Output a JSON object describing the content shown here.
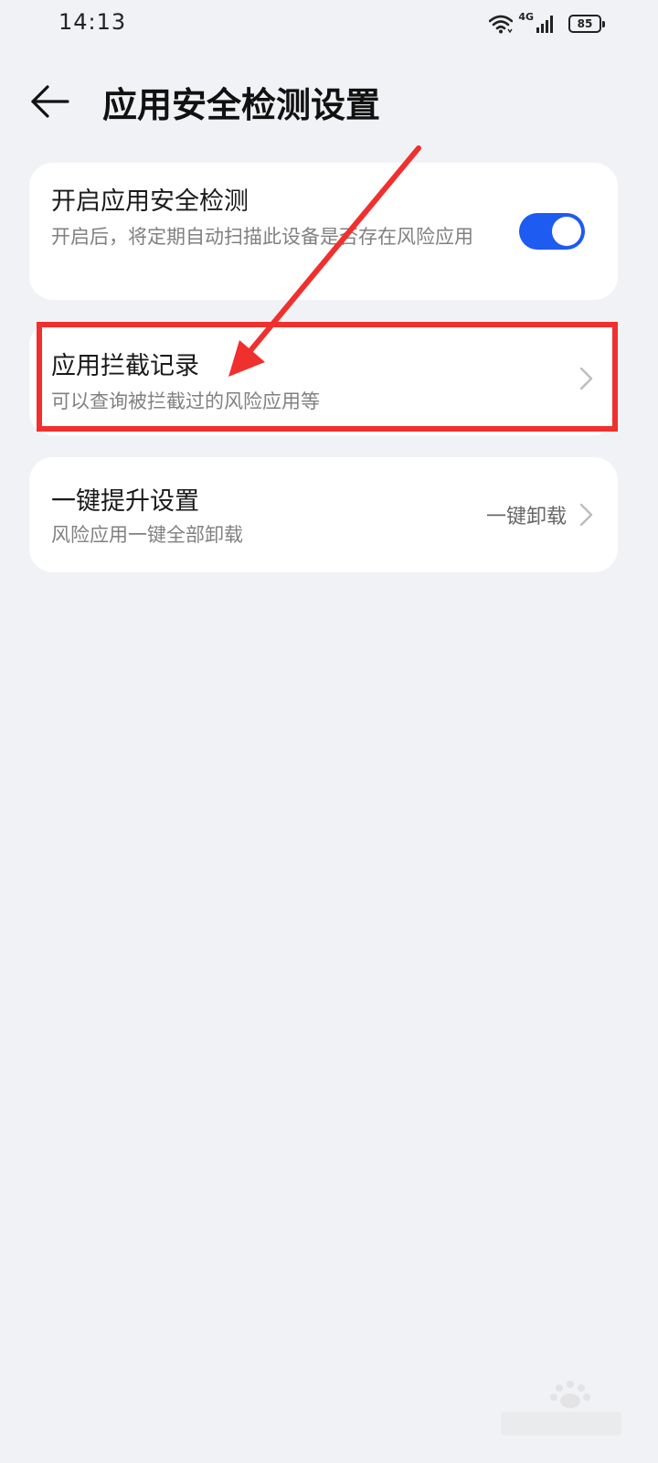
{
  "status_bar": {
    "time": "14:13",
    "network": "4G",
    "battery": "85",
    "icons": [
      "wifi-icon",
      "signal-icon",
      "battery-icon"
    ]
  },
  "header": {
    "title": "应用安全检测设置",
    "back_icon": "back-arrow-icon"
  },
  "settings": {
    "security_scan": {
      "title": "开启应用安全检测",
      "subtitle": "开启后，将定期自动扫描此设备是否存在风险应用",
      "enabled": true
    },
    "block_records": {
      "title": "应用拦截记录",
      "subtitle": "可以查询被拦截过的风险应用等"
    },
    "one_click_upgrade": {
      "title": "一键提升设置",
      "subtitle": "风险应用一键全部卸载",
      "value": "一键卸载"
    }
  },
  "colors": {
    "background": "#f1f2f5",
    "card": "#ffffff",
    "accent": "#1e5bf0",
    "annotation": "#f0302e"
  }
}
